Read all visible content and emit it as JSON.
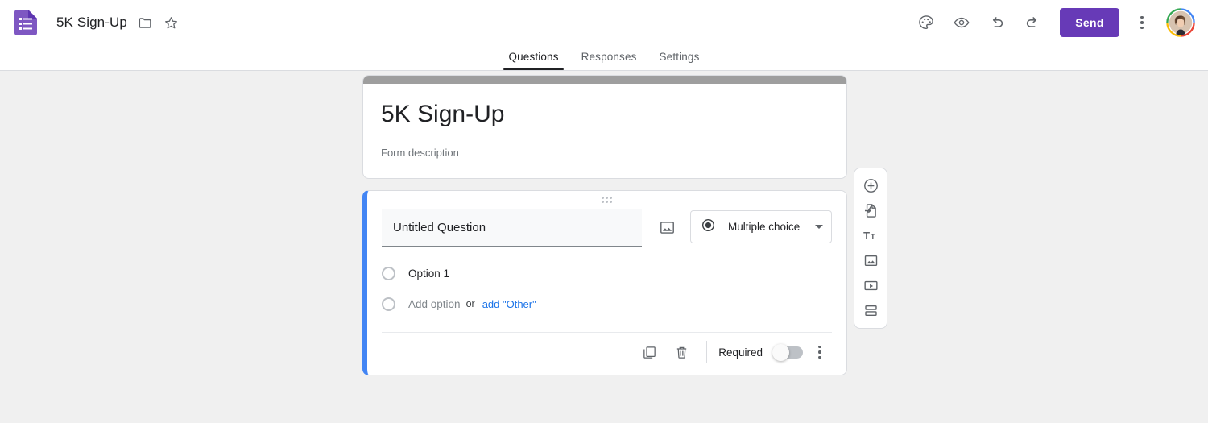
{
  "topbar": {
    "logo_icon": "google-forms-logo",
    "document_title": "5K Sign-Up",
    "move_folder_icon": "folder-icon",
    "star_icon": "star-icon",
    "theme_icon": "palette-icon",
    "preview_icon": "eye-icon",
    "undo_icon": "undo-icon",
    "redo_icon": "redo-icon",
    "send_label": "Send",
    "more_icon": "more-vertical-icon",
    "avatar_icon": "user-avatar"
  },
  "tabs": [
    {
      "label": "Questions",
      "active": true
    },
    {
      "label": "Responses",
      "active": false
    },
    {
      "label": "Settings",
      "active": false
    }
  ],
  "form_header": {
    "title": "5K Sign-Up",
    "description": "Form description",
    "strip_color": "#9e9e9e"
  },
  "question": {
    "accent_color": "#4285f4",
    "drag_handle_icon": "drag-handle-icon",
    "title_value": "Untitled Question",
    "add_image_icon": "image-icon",
    "type_icon": "radio-filled-icon",
    "type_label": "Multiple choice",
    "caret_icon": "chevron-down-icon",
    "options": [
      {
        "label": "Option 1",
        "placeholder": false
      }
    ],
    "add_option": {
      "label": "Add option",
      "or_label": "or",
      "other_label": "add \"Other\"",
      "other_color": "#1a73e8"
    },
    "footer": {
      "duplicate_icon": "duplicate-icon",
      "delete_icon": "trash-icon",
      "required_label": "Required",
      "required_on": false,
      "more_icon": "more-vertical-icon"
    }
  },
  "side_toolbar": [
    {
      "icon": "add-question-icon",
      "name": "add-question"
    },
    {
      "icon": "import-questions-icon",
      "name": "import-questions"
    },
    {
      "icon": "add-title-icon",
      "name": "add-title-and-description"
    },
    {
      "icon": "add-image-icon",
      "name": "add-image"
    },
    {
      "icon": "add-video-icon",
      "name": "add-video"
    },
    {
      "icon": "add-section-icon",
      "name": "add-section"
    }
  ],
  "colors": {
    "brand_purple": "#673ab7",
    "accent_blue": "#4285f4",
    "link_blue": "#1a73e8",
    "canvas_bg": "#f0f0f0"
  }
}
